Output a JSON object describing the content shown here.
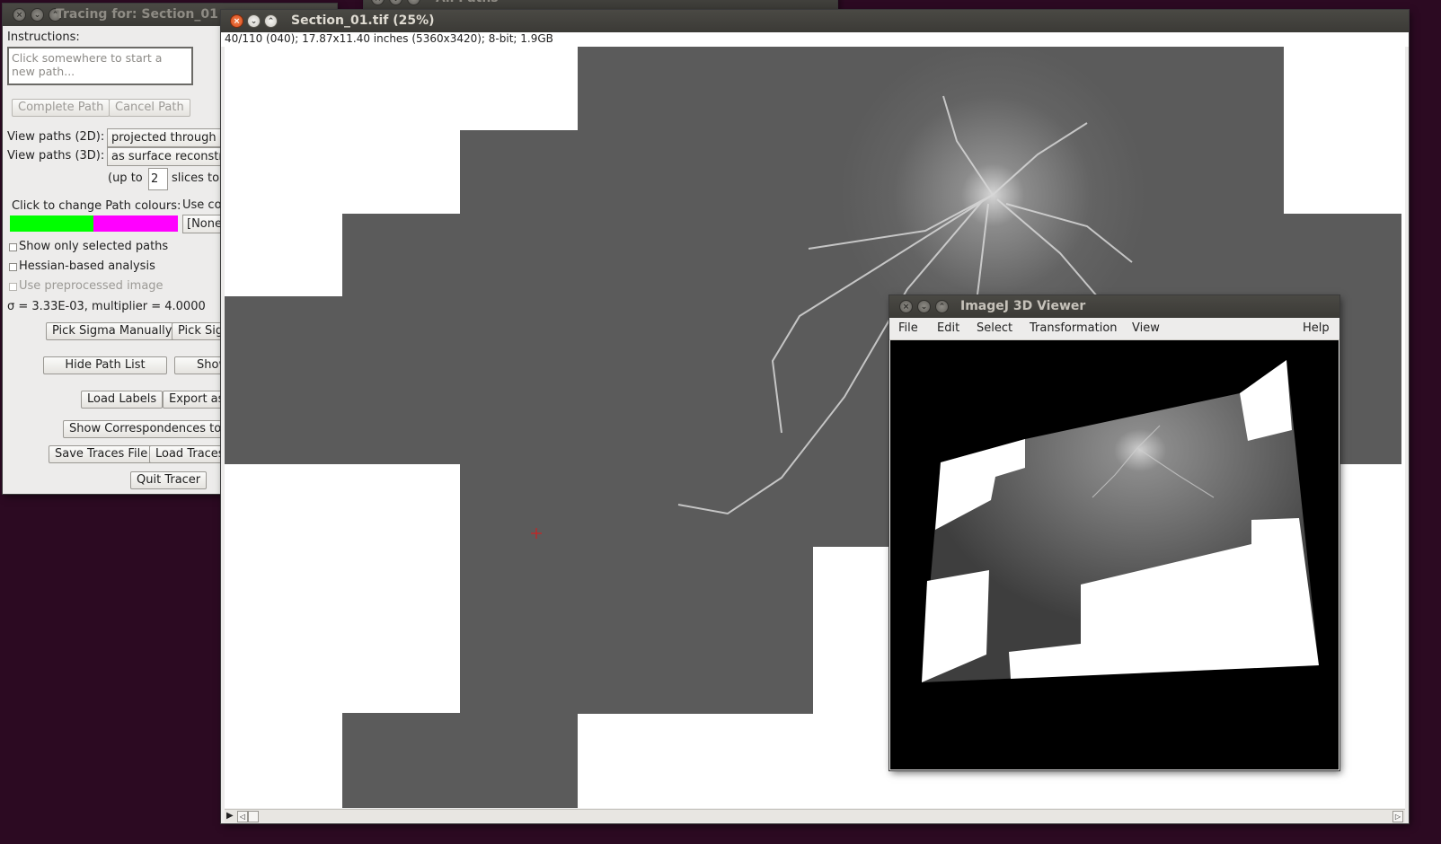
{
  "tracing": {
    "title": "Tracing for: Section_01",
    "instructions_label": "Instructions:",
    "instructions_text": "Click somewhere to start a new path...",
    "complete_path": "Complete Path",
    "cancel_path": "Cancel Path",
    "view2d_label": "View paths (2D):",
    "view2d_value": "projected through a",
    "view3d_label": "View paths (3D):",
    "view3d_value": "as surface reconstr",
    "upto_prefix": "(up to",
    "upto_value": "2",
    "upto_suffix": "slices to",
    "colours_label": "Click to change Path colours:",
    "use_colour_label": "Use co",
    "use_colour_value": "[None",
    "colours": {
      "selected": "#00ff00",
      "deselected": "#ff00ff"
    },
    "show_selected": "Show only selected paths",
    "hessian": "Hessian-based analysis",
    "preprocessed": "Use preprocessed image",
    "sigma_text": "σ = 3.33E-03, multiplier = 4.0000",
    "pick_sigma_manually": "Pick Sigma Manually",
    "pick_sigma_other": "Pick Sig",
    "hide_path_list": "Hide Path List",
    "show_other": "Show",
    "load_labels": "Load Labels",
    "export_as": "Export as",
    "show_correspondences": "Show Correspondences to T",
    "save_traces": "Save Traces File",
    "load_traces": "Load Traces",
    "quit_tracer": "Quit Tracer"
  },
  "all_paths": {
    "title": "All Paths"
  },
  "main": {
    "title": "Section_01.tif (25%)",
    "info": "40/110 (040); 17.87x11.40 inches (5360x3420); 8-bit; 1.9GB"
  },
  "viewer": {
    "title": "ImageJ 3D Viewer",
    "menus": [
      "File",
      "Edit",
      "Select",
      "Transformation",
      "View",
      "Help"
    ]
  }
}
